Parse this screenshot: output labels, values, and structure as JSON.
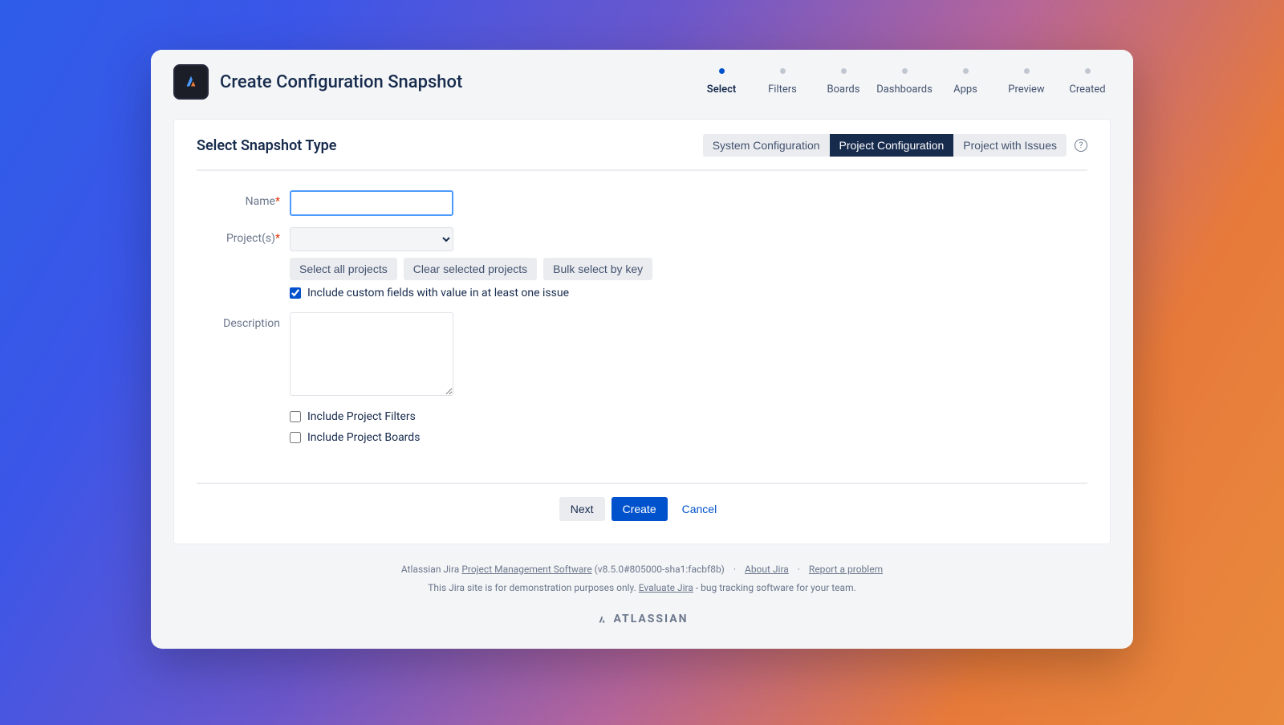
{
  "header": {
    "title": "Create Configuration Snapshot",
    "steps": [
      {
        "label": "Select",
        "active": true
      },
      {
        "label": "Filters",
        "active": false
      },
      {
        "label": "Boards",
        "active": false
      },
      {
        "label": "Dashboards",
        "active": false
      },
      {
        "label": "Apps",
        "active": false
      },
      {
        "label": "Preview",
        "active": false
      },
      {
        "label": "Created",
        "active": false
      }
    ]
  },
  "panel": {
    "title": "Select Snapshot Type",
    "type_tabs": [
      {
        "label": "System Configuration",
        "active": false
      },
      {
        "label": "Project Configuration",
        "active": true
      },
      {
        "label": "Project with Issues",
        "active": false
      }
    ]
  },
  "form": {
    "name_label": "Name",
    "name_value": "",
    "projects_label": "Project(s)",
    "projects_value": "",
    "btn_select_all": "Select all projects",
    "btn_clear": "Clear selected projects",
    "btn_bulk": "Bulk select by key",
    "include_custom_fields_label": "Include custom fields with value in at least one issue",
    "include_custom_fields_checked": true,
    "description_label": "Description",
    "description_value": "",
    "include_filters_label": "Include Project Filters",
    "include_filters_checked": false,
    "include_boards_label": "Include Project Boards",
    "include_boards_checked": false
  },
  "actions": {
    "next": "Next",
    "create": "Create",
    "cancel": "Cancel"
  },
  "footer": {
    "line1_prefix": "Atlassian Jira ",
    "line1_link": "Project Management Software",
    "line1_suffix": " (v8.5.0#805000-sha1:facbf8b)",
    "about": "About Jira",
    "report": "Report a problem",
    "line2_prefix": "This Jira site is for demonstration purposes only. ",
    "line2_link": "Evaluate Jira",
    "line2_suffix": " - bug tracking software for your team.",
    "brand": "ATLASSIAN"
  }
}
